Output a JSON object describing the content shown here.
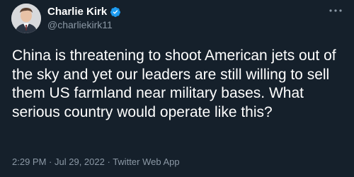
{
  "author": {
    "display_name": "Charlie Kirk",
    "handle": "@charliekirk11",
    "verified": true,
    "verified_color": "#1d9bf0"
  },
  "tweet": {
    "text": "China is threatening to shoot American jets out of the sky and yet our leaders are still willing to sell them US farmland near military bases. What serious country would operate like this?"
  },
  "meta": {
    "time": "2:29 PM",
    "separator": "·",
    "date": "Jul 29, 2022",
    "source": "Twitter Web App"
  },
  "icons": {
    "verified": "verified-badge-icon",
    "more": "more-options-icon"
  },
  "colors": {
    "background": "#15202b",
    "primary_text": "#ffffff",
    "secondary_text": "#8b98a5"
  }
}
